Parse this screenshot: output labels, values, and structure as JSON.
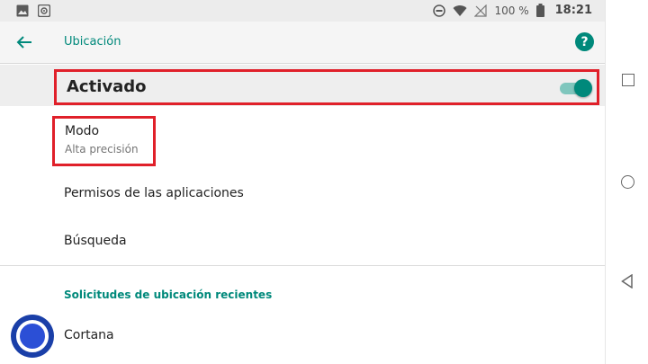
{
  "status_bar": {
    "battery_text": "100 %",
    "time": "18:21",
    "icons": [
      "image-icon",
      "photo-badge-icon",
      "do-not-disturb-icon",
      "wifi-icon",
      "no-signal-icon",
      "battery-icon"
    ]
  },
  "toolbar": {
    "title": "Ubicación",
    "back_icon": "arrow-back-icon",
    "help_icon": "help-icon",
    "help_glyph": "?"
  },
  "master_switch": {
    "label": "Activado",
    "checked": true
  },
  "mode": {
    "title": "Modo",
    "subtitle": "Alta precisión"
  },
  "items": [
    {
      "label": "Permisos de las aplicaciones"
    },
    {
      "label": "Búsqueda"
    }
  ],
  "recent_section": {
    "header": "Solicitudes de ubicación recientes",
    "apps": [
      {
        "label": "Cortana",
        "icon": "cortana-icon"
      }
    ]
  },
  "navigation": {
    "buttons": [
      "recents-icon",
      "home-icon",
      "back-icon"
    ]
  },
  "colors": {
    "accent": "#00897b",
    "accent_light": "#7fc6bd",
    "highlight_border": "#e0202a",
    "status_bar_bg": "#ececec",
    "toolbar_bg": "#f5f5f5",
    "cortana_blue": "#1a3fa8"
  }
}
